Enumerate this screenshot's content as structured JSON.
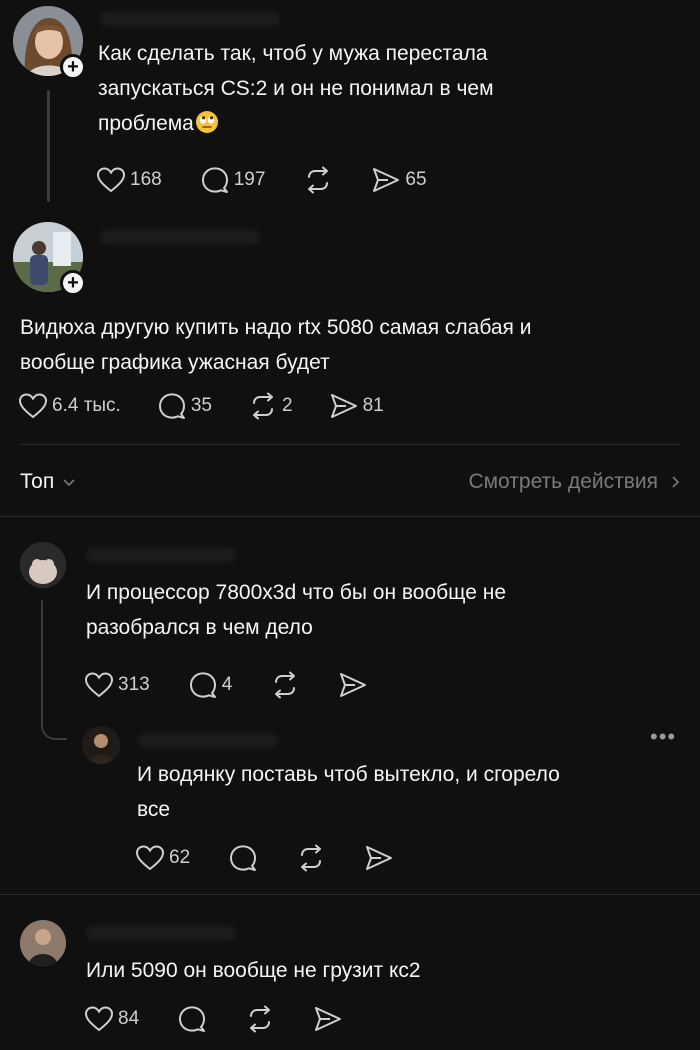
{
  "post": {
    "text_lines": [
      "Как сделать так, чтоб у мужа перестала",
      "запускаться CS:2 и он не понимал в чем",
      "проблема"
    ],
    "emoji": "face-with-rolling-eyes",
    "likes": "168",
    "replies": "197",
    "shares": "65"
  },
  "reply1": {
    "text_lines": [
      "Видюха другую купить надо rtx 5080 самая слабая и",
      "вообще графика ужасная будет"
    ],
    "likes": "6.4 тыс.",
    "replies": "35",
    "reposts": "2",
    "shares": "81"
  },
  "sort": {
    "label": "Топ",
    "activity_link": "Смотреть действия"
  },
  "comments": [
    {
      "text_lines": [
        "И процессор 7800х3d что бы он вообще не",
        "разобрался в чем дело"
      ],
      "likes": "313",
      "replies": "4"
    },
    {
      "text_lines": [
        "И водянку поставь чтоб вытекло, и сгорело",
        "все"
      ],
      "likes": "62",
      "more": "•••"
    },
    {
      "text_lines": [
        "Или 5090 он вообще не грузит кс2"
      ],
      "likes": "84"
    }
  ],
  "colors": {
    "background": "#101010",
    "text": "#f3f5f7",
    "muted": "#7a7a7a",
    "icon": "#cfcfcf"
  }
}
